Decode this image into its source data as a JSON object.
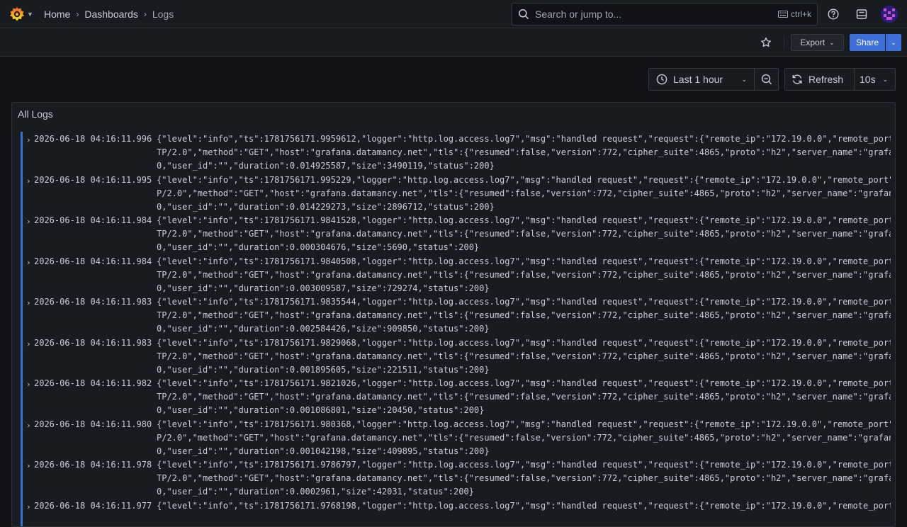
{
  "breadcrumb": [
    {
      "label": "Home"
    },
    {
      "label": "Dashboards"
    },
    {
      "label": "Logs"
    }
  ],
  "search": {
    "placeholder": "Search or jump to...",
    "shortcut": "ctrl+k"
  },
  "toolbar": {
    "export_label": "Export",
    "share_label": "Share"
  },
  "time_controls": {
    "range_label": "Last 1 hour",
    "refresh_label": "Refresh",
    "interval_label": "10s"
  },
  "panel": {
    "title": "All Logs"
  },
  "colors": {
    "accent": "#3274d9",
    "share": "#3d71d9",
    "background": "#111217"
  },
  "logs": [
    {
      "ts": "2026-06-18 04:16:11.996",
      "line1": "{\"level\":\"info\",\"ts\":1781756171.9959612,\"logger\":\"http.log.access.log7\",\"msg\":\"handled request\",\"request\":{\"remote_ip\":\"172.19.0.0\",\"remote_port\"",
      "line2": "TP/2.0\",\"method\":\"GET\",\"host\":\"grafana.datamancy.net\",\"tls\":{\"resumed\":false,\"version\":772,\"cipher_suite\":4865,\"proto\":\"h2\",\"server_name\":\"grafan",
      "line3": "0,\"user_id\":\"\",\"duration\":0.014925587,\"size\":3490119,\"status\":200}"
    },
    {
      "ts": "2026-06-18 04:16:11.995",
      "line1": "{\"level\":\"info\",\"ts\":1781756171.995229,\"logger\":\"http.log.access.log7\",\"msg\":\"handled request\",\"request\":{\"remote_ip\":\"172.19.0.0\",\"remote_port\":",
      "line2": "P/2.0\",\"method\":\"GET\",\"host\":\"grafana.datamancy.net\",\"tls\":{\"resumed\":false,\"version\":772,\"cipher_suite\":4865,\"proto\":\"h2\",\"server_name\":\"grafana",
      "line3": "0,\"user_id\":\"\",\"duration\":0.014229273,\"size\":2896712,\"status\":200}"
    },
    {
      "ts": "2026-06-18 04:16:11.984",
      "line1": "{\"level\":\"info\",\"ts\":1781756171.9841528,\"logger\":\"http.log.access.log7\",\"msg\":\"handled request\",\"request\":{\"remote_ip\":\"172.19.0.0\",\"remote_port\"",
      "line2": "TP/2.0\",\"method\":\"GET\",\"host\":\"grafana.datamancy.net\",\"tls\":{\"resumed\":false,\"version\":772,\"cipher_suite\":4865,\"proto\":\"h2\",\"server_name\":\"grafan",
      "line3": "0,\"user_id\":\"\",\"duration\":0.000304676,\"size\":5690,\"status\":200}"
    },
    {
      "ts": "2026-06-18 04:16:11.984",
      "line1": "{\"level\":\"info\",\"ts\":1781756171.9840508,\"logger\":\"http.log.access.log7\",\"msg\":\"handled request\",\"request\":{\"remote_ip\":\"172.19.0.0\",\"remote_port\"",
      "line2": "TP/2.0\",\"method\":\"GET\",\"host\":\"grafana.datamancy.net\",\"tls\":{\"resumed\":false,\"version\":772,\"cipher_suite\":4865,\"proto\":\"h2\",\"server_name\":\"grafan",
      "line3": "0,\"user_id\":\"\",\"duration\":0.003009587,\"size\":729274,\"status\":200}"
    },
    {
      "ts": "2026-06-18 04:16:11.983",
      "line1": "{\"level\":\"info\",\"ts\":1781756171.9835544,\"logger\":\"http.log.access.log7\",\"msg\":\"handled request\",\"request\":{\"remote_ip\":\"172.19.0.0\",\"remote_port\"",
      "line2": "TP/2.0\",\"method\":\"GET\",\"host\":\"grafana.datamancy.net\",\"tls\":{\"resumed\":false,\"version\":772,\"cipher_suite\":4865,\"proto\":\"h2\",\"server_name\":\"grafan",
      "line3": "0,\"user_id\":\"\",\"duration\":0.002584426,\"size\":909850,\"status\":200}"
    },
    {
      "ts": "2026-06-18 04:16:11.983",
      "line1": "{\"level\":\"info\",\"ts\":1781756171.9829068,\"logger\":\"http.log.access.log7\",\"msg\":\"handled request\",\"request\":{\"remote_ip\":\"172.19.0.0\",\"remote_port\"",
      "line2": "TP/2.0\",\"method\":\"GET\",\"host\":\"grafana.datamancy.net\",\"tls\":{\"resumed\":false,\"version\":772,\"cipher_suite\":4865,\"proto\":\"h2\",\"server_name\":\"grafan",
      "line3": "0,\"user_id\":\"\",\"duration\":0.001895605,\"size\":221511,\"status\":200}"
    },
    {
      "ts": "2026-06-18 04:16:11.982",
      "line1": "{\"level\":\"info\",\"ts\":1781756171.9821026,\"logger\":\"http.log.access.log7\",\"msg\":\"handled request\",\"request\":{\"remote_ip\":\"172.19.0.0\",\"remote_port\"",
      "line2": "TP/2.0\",\"method\":\"GET\",\"host\":\"grafana.datamancy.net\",\"tls\":{\"resumed\":false,\"version\":772,\"cipher_suite\":4865,\"proto\":\"h2\",\"server_name\":\"grafan",
      "line3": "0,\"user_id\":\"\",\"duration\":0.001086801,\"size\":20450,\"status\":200}"
    },
    {
      "ts": "2026-06-18 04:16:11.980",
      "line1": "{\"level\":\"info\",\"ts\":1781756171.980368,\"logger\":\"http.log.access.log7\",\"msg\":\"handled request\",\"request\":{\"remote_ip\":\"172.19.0.0\",\"remote_port\":",
      "line2": "P/2.0\",\"method\":\"GET\",\"host\":\"grafana.datamancy.net\",\"tls\":{\"resumed\":false,\"version\":772,\"cipher_suite\":4865,\"proto\":\"h2\",\"server_name\":\"grafana",
      "line3": "0,\"user_id\":\"\",\"duration\":0.001042198,\"size\":409895,\"status\":200}"
    },
    {
      "ts": "2026-06-18 04:16:11.978",
      "line1": "{\"level\":\"info\",\"ts\":1781756171.9786797,\"logger\":\"http.log.access.log7\",\"msg\":\"handled request\",\"request\":{\"remote_ip\":\"172.19.0.0\",\"remote_port\"",
      "line2": "TP/2.0\",\"method\":\"GET\",\"host\":\"grafana.datamancy.net\",\"tls\":{\"resumed\":false,\"version\":772,\"cipher_suite\":4865,\"proto\":\"h2\",\"server_name\":\"grafan",
      "line3": "0,\"user_id\":\"\",\"duration\":0.0002961,\"size\":42031,\"status\":200}"
    },
    {
      "ts": "2026-06-18 04:16:11.977",
      "line1": "{\"level\":\"info\",\"ts\":1781756171.9768198,\"logger\":\"http.log.access.log7\",\"msg\":\"handled request\",\"request\":{\"remote_ip\":\"172.19.0.0\",\"remote_port\"",
      "line2": "",
      "line3": ""
    }
  ]
}
